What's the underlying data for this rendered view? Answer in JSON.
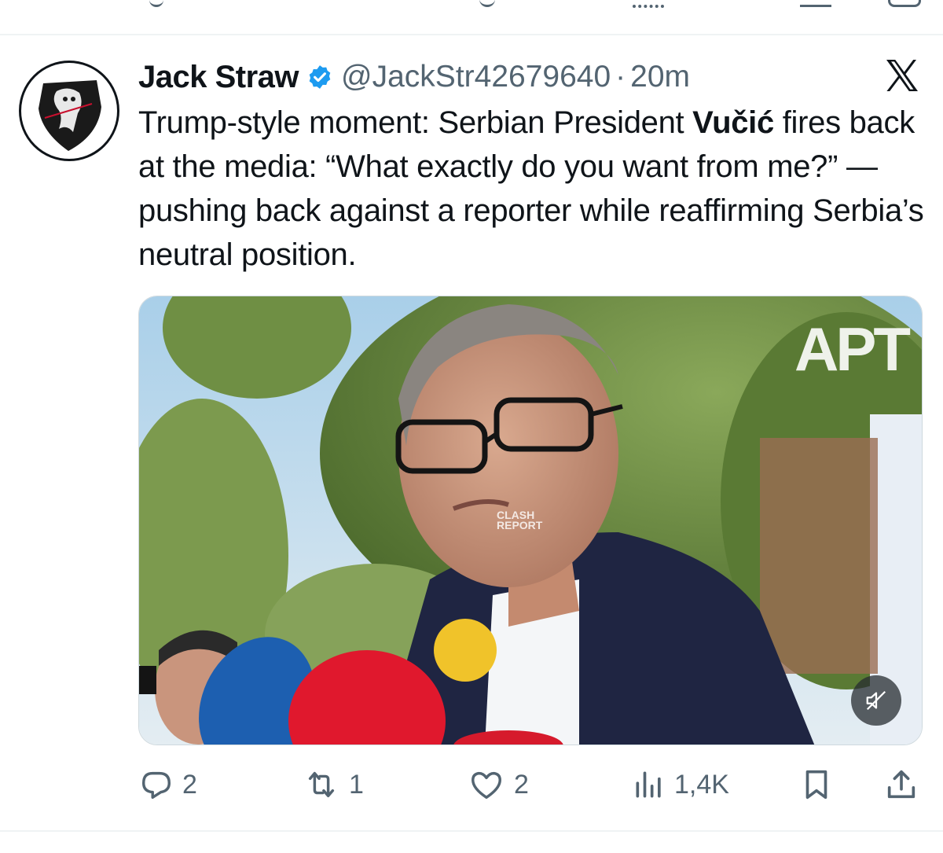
{
  "tweet": {
    "author_name": "Jack Straw",
    "handle": "@JackStr42679640",
    "separator": "·",
    "time": "20m",
    "text_part1": "Trump-style moment: Serbian President ",
    "text_bold": "Vučić",
    "text_part2": " fires back at the media: “What exactly do you want from me?” — pushing back against a reporter while reaffirming Serbia’s neutral position.",
    "media": {
      "watermark_main": "APT",
      "watermark_brand_line1": "CLASH",
      "watermark_brand_line2": "REPORT",
      "mute_icon": "speaker-muted-icon"
    },
    "actions": {
      "replies": "2",
      "retweets": "1",
      "likes": "2",
      "views": "1,4K"
    }
  },
  "colors": {
    "text_primary": "#0f1419",
    "text_secondary": "#536471",
    "verified_blue": "#1d9bf0",
    "divider": "#eff3f4"
  },
  "icons": [
    "x-logo-icon",
    "verified-badge-icon",
    "reply-icon",
    "retweet-icon",
    "like-icon",
    "views-icon",
    "bookmark-icon",
    "share-icon"
  ]
}
